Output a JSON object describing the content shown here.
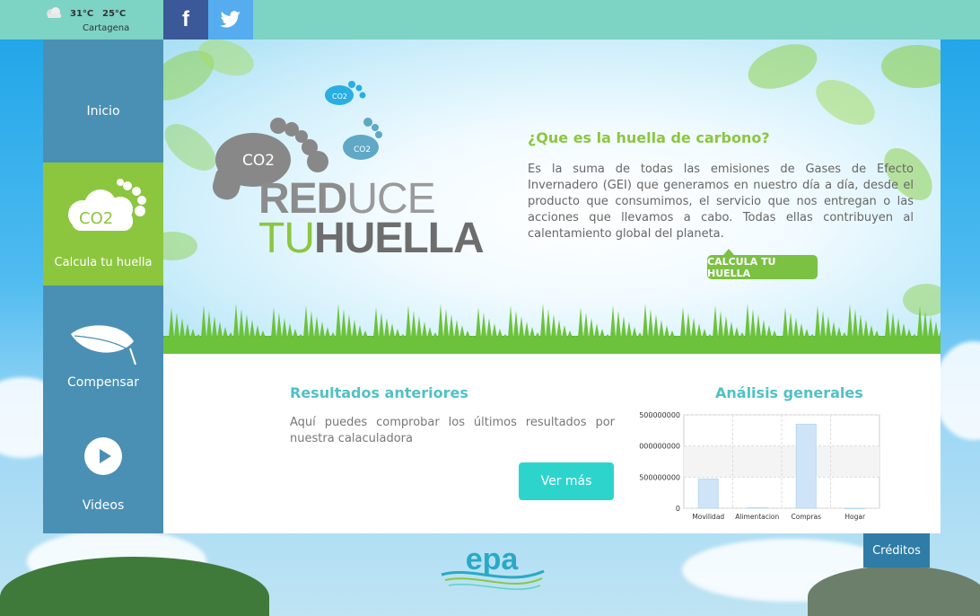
{
  "weather": {
    "icon": "cloudy-icon",
    "temp_max": "31°C",
    "temp_min": "25°C",
    "city": "Cartagena"
  },
  "social": {
    "facebook_icon": "facebook-icon",
    "facebook_glyph": "f",
    "twitter_icon": "twitter-icon"
  },
  "sidebar": {
    "items": [
      {
        "label": "Inicio",
        "active": false
      },
      {
        "label": "Calcula tu huella",
        "active": true,
        "icon": "co2-cloud-icon",
        "icon_text": "CO2"
      },
      {
        "label": "Compensar",
        "active": false,
        "icon": "leaf-icon"
      },
      {
        "label": "Videos",
        "active": false,
        "icon": "play-icon"
      }
    ]
  },
  "hero": {
    "logo": {
      "line1_bold": "RED",
      "line1_light": "UCE",
      "line2_light": "TU",
      "line2_bold": "HUELLA",
      "footprint_labels": [
        "CO2",
        "CO2",
        "CO2"
      ]
    },
    "title": "¿Que es la huella de carbono?",
    "text": "Es la suma de todas las emisiones de Gases de Efecto Invernadero (GEI) que generamos en nuestro día a día, desde el producto que consumimos, el servicio que nos entregan o las acciones que llevamos a cabo. Todas ellas contribuyen al calentamiento global del planeta.",
    "cta_label": "CALCULA TU HUELLA"
  },
  "results": {
    "title": "Resultados anteriores",
    "text": "Aquí puedes comprobar los últimos resultados por nuestra calaculadora",
    "button_label": "Ver más"
  },
  "analysis": {
    "title": "Análisis generales"
  },
  "chart_data": {
    "type": "bar",
    "categories": [
      "Movilidad",
      "Alimentacion",
      "Compras",
      "Hogar"
    ],
    "values": [
      470000000,
      10000000,
      1350000000,
      0
    ],
    "ylim": [
      0,
      1500000000
    ],
    "yticks": [
      "0",
      "500000000",
      "000000000",
      "500000000"
    ],
    "bar_color": "#cfe5f7",
    "grid": true
  },
  "footer": {
    "logo": "epa-logo",
    "logo_text": "epa",
    "credits_label": "Créditos"
  }
}
